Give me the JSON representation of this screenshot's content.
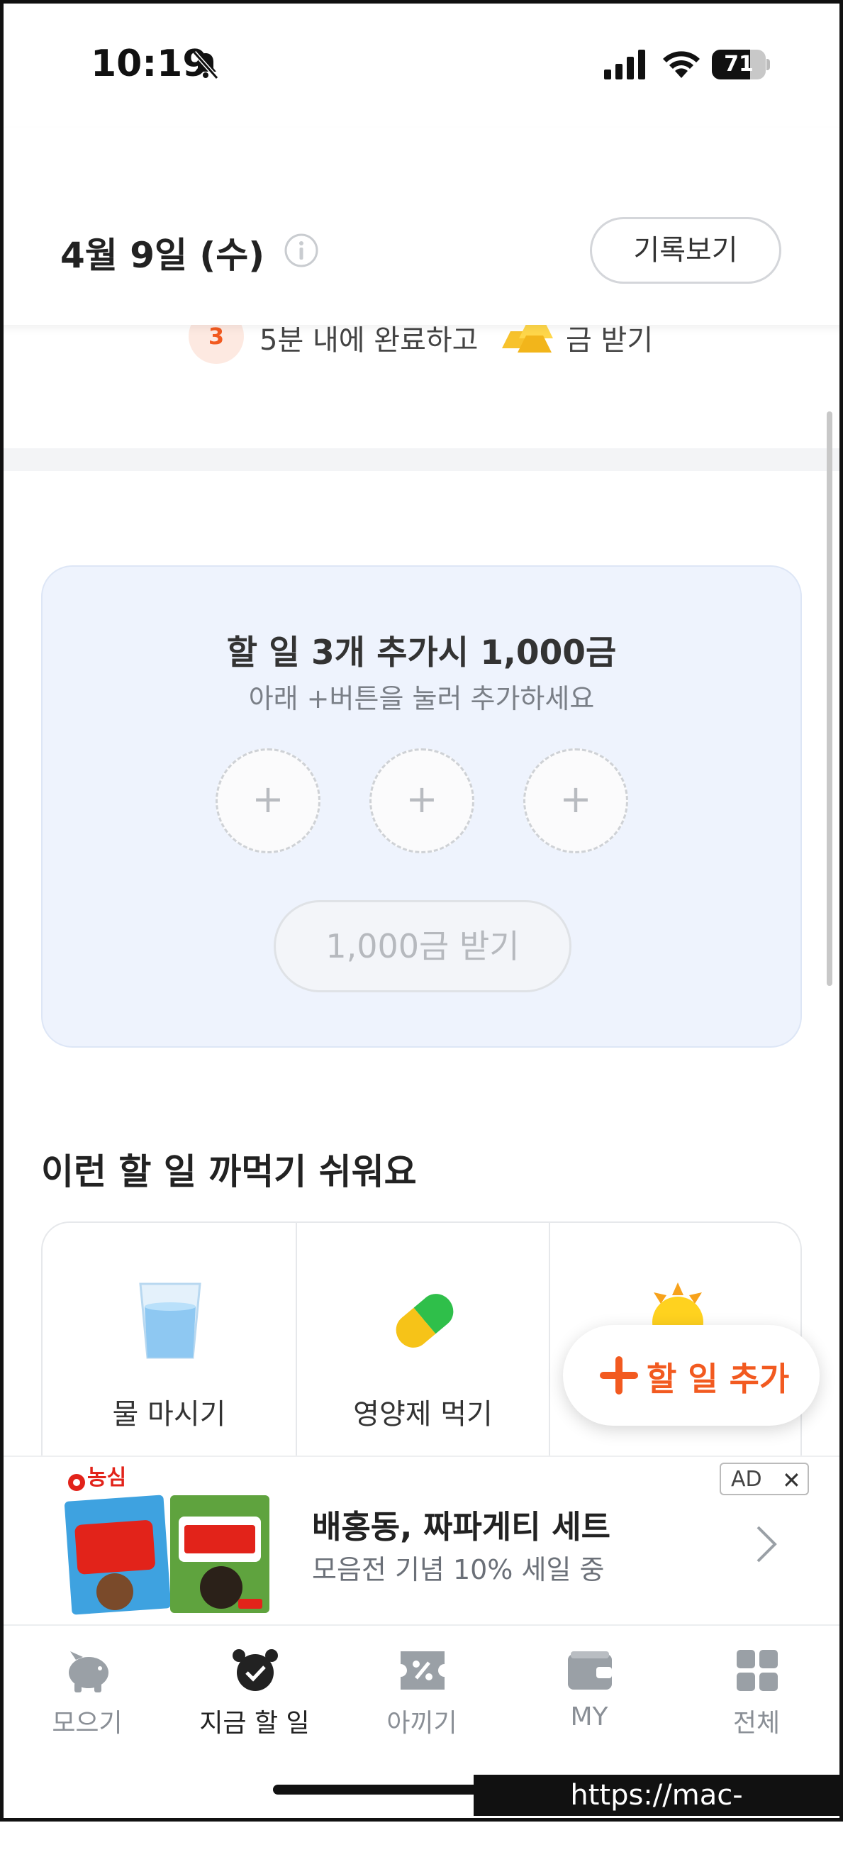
{
  "status_bar": {
    "time": "10:19",
    "battery": "71",
    "battery_level": 0.71
  },
  "header": {
    "date": "4월 9일 (수)",
    "history_button": "기록보기"
  },
  "step": {
    "number": "3",
    "text_before": "5분 내에 완료하고",
    "text_after": "금 받기"
  },
  "promo_card": {
    "title": "할 일 3개 추가시 1,000금",
    "subtitle": "아래 +버튼을 눌러 추가하세요",
    "slots": [
      "+",
      "+",
      "+"
    ],
    "claim_button": "1,000금 받기"
  },
  "easy_tasks": {
    "title": "이런 할 일 까먹기 쉬워요",
    "items": [
      {
        "label": "물 마시기",
        "icon": "water-glass-icon"
      },
      {
        "label": "영양제 먹기",
        "icon": "pill-capsule-icon"
      },
      {
        "label": "",
        "icon": "sun-icon"
      }
    ]
  },
  "fab": {
    "label": "할 일 추가"
  },
  "ad": {
    "title": "배홍동, 짜파게티 세트",
    "subtitle": "모음전 기념 10% 세일 중",
    "badge": "AD",
    "close": "✕",
    "brand_logo": "농심",
    "colors": {
      "brand_red": "#e2231a"
    }
  },
  "nav": {
    "items": [
      {
        "label": "모으기",
        "icon": "piggy-bank-icon"
      },
      {
        "label": "지금 할 일",
        "icon": "alarm-clock-icon"
      },
      {
        "label": "아끼기",
        "icon": "coupon-percent-icon"
      },
      {
        "label": "MY",
        "icon": "wallet-icon"
      },
      {
        "label": "전체",
        "icon": "grid-menu-icon"
      }
    ],
    "active_index": 1
  },
  "watermark": "https://mac-os.tistory.com",
  "colors": {
    "accent": "#f25a20",
    "card_bg": "#eef3fd",
    "muted": "#8a8f96"
  }
}
